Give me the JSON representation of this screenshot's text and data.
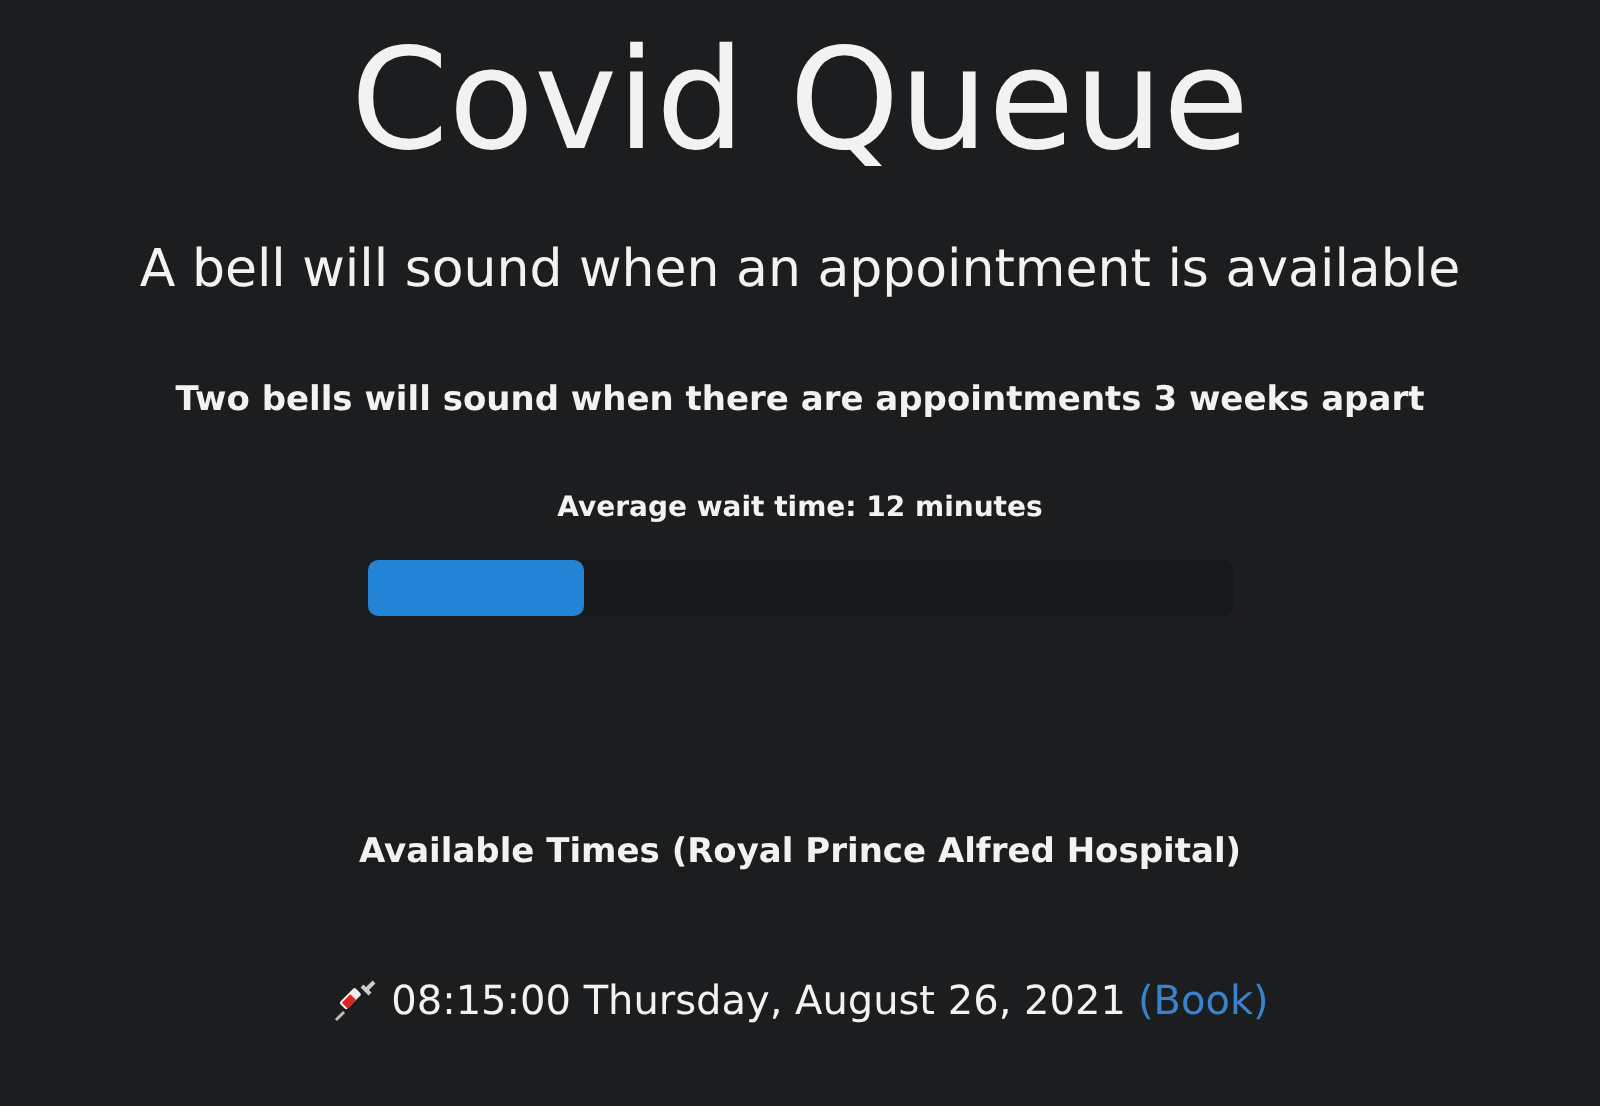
{
  "title": "Covid Queue",
  "subtitle": "A bell will sound when an appointment is available",
  "notice": "Two bells will sound when there are appointments 3 weeks apart",
  "wait": {
    "label": "Average wait time: 12 minutes",
    "level": 0.25
  },
  "available": {
    "heading": "Available Times (Royal Prince Alfred Hospital)",
    "slots": [
      {
        "time": "08:15:00 Thursday, August 26, 2021",
        "link": "(Book)"
      }
    ]
  }
}
